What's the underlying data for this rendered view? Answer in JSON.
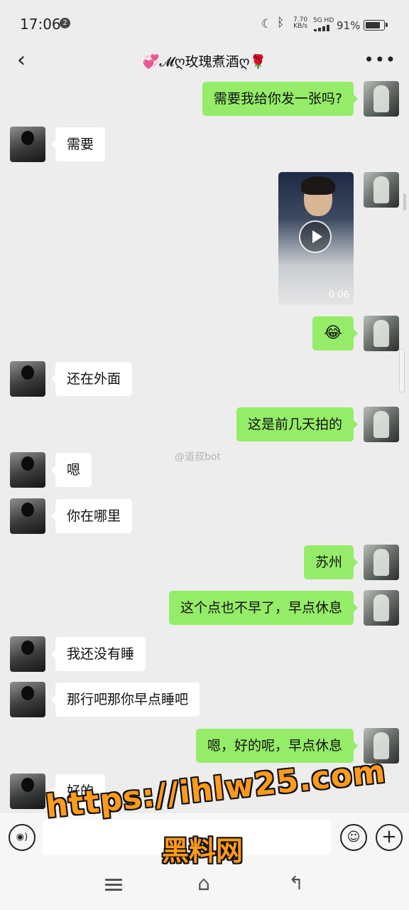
{
  "status_bar": {
    "time": "17:06",
    "notification_count": "2",
    "net_speed_value": "7.70",
    "net_speed_unit": "KB/s",
    "signal_label": "5G HD",
    "battery_percent": "91%",
    "battery_level": 0.91
  },
  "header": {
    "title": "💞𝓜ღ玫瑰煮酒ღ🌹"
  },
  "messages": [
    {
      "from": "me",
      "type": "text",
      "text": "需要我给你发一张吗?"
    },
    {
      "from": "other",
      "type": "text",
      "text": "需要"
    },
    {
      "from": "me",
      "type": "video",
      "duration": "0:06"
    },
    {
      "from": "me",
      "type": "emoji",
      "text": "😂"
    },
    {
      "from": "other",
      "type": "text",
      "text": "还在外面"
    },
    {
      "from": "me",
      "type": "text",
      "text": "这是前几天拍的"
    },
    {
      "from": "other",
      "type": "text",
      "text": "嗯"
    },
    {
      "from": "other",
      "type": "text",
      "text": "你在哪里"
    },
    {
      "from": "me",
      "type": "text",
      "text": "苏州"
    },
    {
      "from": "me",
      "type": "text",
      "text": "这个点也不早了，早点休息"
    },
    {
      "from": "other",
      "type": "text",
      "text": "我还没有睡"
    },
    {
      "from": "other",
      "type": "text",
      "text": "那行吧那你早点睡吧"
    },
    {
      "from": "me",
      "type": "text",
      "text": "嗯，好的呢，早点休息"
    },
    {
      "from": "other",
      "type": "text",
      "text": "好的"
    }
  ],
  "watermark": "@道叔bot",
  "input": {
    "value": "",
    "placeholder": ""
  },
  "overlay": {
    "url": "https://ihlw25.com",
    "name": "黑料网"
  },
  "colors": {
    "my_bubble": "#95ec69",
    "other_bubble": "#ffffff",
    "chat_background": "#ededed",
    "overlay_text": "#ff9a1a"
  },
  "icons": {
    "back": "chevron-left-icon",
    "more": "more-dots-icon",
    "voice": "voice-icon",
    "emoji": "emoji-icon",
    "plus": "plus-icon",
    "nav_menu": "menu-icon",
    "nav_home": "home-icon",
    "nav_back": "back-icon"
  }
}
